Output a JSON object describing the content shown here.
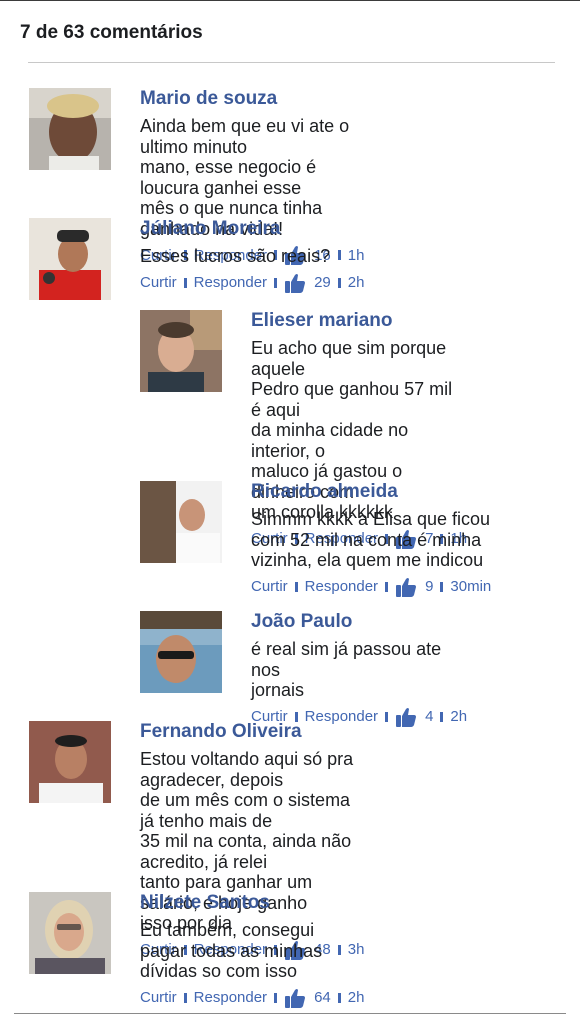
{
  "header": {
    "title": "7 de 63 comentários"
  },
  "actions": {
    "like_label": "Curtir",
    "reply_label": "Responder"
  },
  "comments": [
    {
      "name": "Mario de souza",
      "text": "Ainda bem que eu vi ate o ultimo minuto\nmano, esse negocio é loucura ganhei esse\nmês o que nunca tinha ganhado na vida!!",
      "likes": "16",
      "time": "1h"
    },
    {
      "name": "Júliano Moreira",
      "text": "Esses lucros são reais?",
      "likes": "29",
      "time": "2h"
    },
    {
      "name": "Elieser mariano",
      "text": "Eu acho que sim porque aquele\nPedro que ganhou 57 mil é aqui\nda minha cidade no interior, o\nmaluco já gastou o dinheiro com\num corolla kkkkkk",
      "likes": "7",
      "time": "1h"
    },
    {
      "name": "Ricardo almeida",
      "text": "Simmm kkkk a Elisa que ficou\ncom 52 mil na conta é minha\nvizinha, ela quem me indicou",
      "likes": "9",
      "time": "30min"
    },
    {
      "name": "João Paulo",
      "text": "é real sim já passou ate nos\njornais",
      "likes": "4",
      "time": "2h"
    },
    {
      "name": "Fernando Oliveira",
      "text": "Estou voltando aqui só pra agradecer, depois\nde um mês com o sistema já tenho mais de\n35 mil na conta, ainda não acredito, já relei\ntanto para ganhar um salário, e hoje ganho\nisso por dia",
      "likes": "48",
      "time": "3h"
    },
    {
      "name": "Nilzete Santos",
      "text": "Eu também, consegui pagar todas as minhas\ndívidas so com isso",
      "likes": "64",
      "time": "2h"
    }
  ]
}
